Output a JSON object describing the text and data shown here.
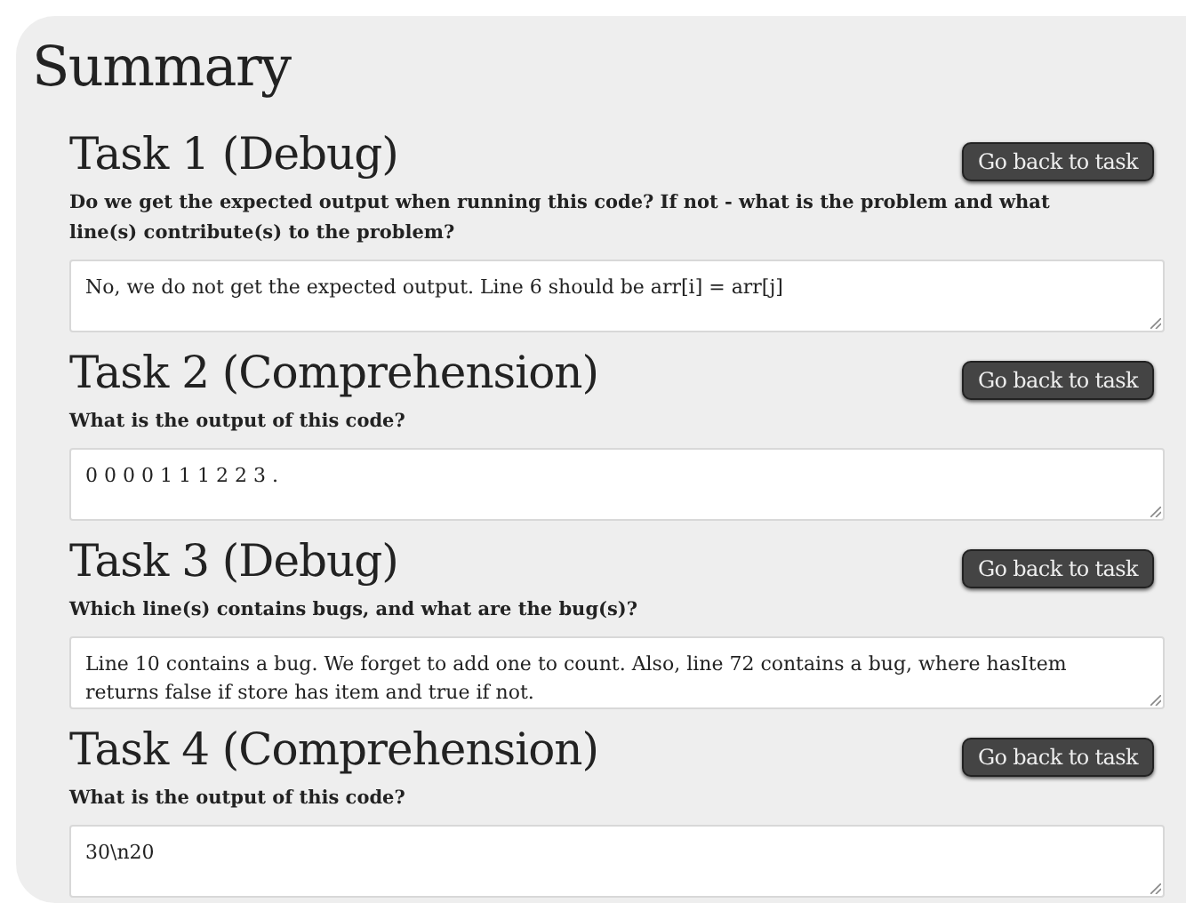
{
  "title": "Summary",
  "tasks": [
    {
      "heading": "Task 1 (Debug)",
      "button": "Go back to task",
      "question": "Do we get the expected output when running this code? If not - what is the problem and what line(s) contribute(s) to the problem?",
      "answer": "No, we do not get the expected output. Line 6 should be arr[i] = arr[j]"
    },
    {
      "heading": "Task 2 (Comprehension)",
      "button": "Go back to task",
      "question": "What is the output of this code?",
      "answer": "0 0 0 0 1 1 1 2 2 3 ."
    },
    {
      "heading": "Task 3 (Debug)",
      "button": "Go back to task",
      "question": "Which line(s) contains bugs, and what are the bug(s)?",
      "answer": "Line 10 contains a bug. We forget to add one to count. Also, line 72 contains a bug, where hasItem returns false if store has item and true if not."
    },
    {
      "heading": "Task 4 (Comprehension)",
      "button": "Go back to task",
      "question": "What is the output of this code?",
      "answer": "30\\n20"
    }
  ]
}
